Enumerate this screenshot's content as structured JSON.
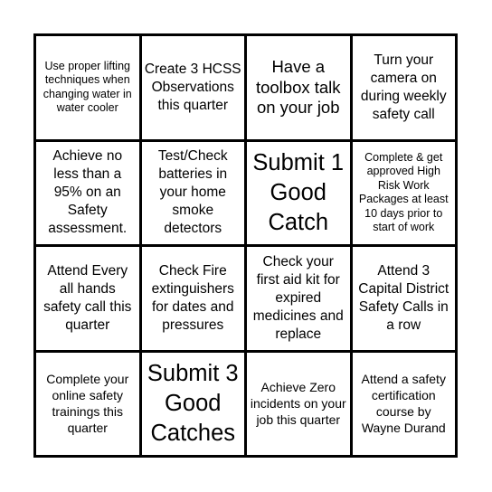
{
  "board": {
    "rows": [
      [
        {
          "text": "Use proper lifting techniques when changing water in water cooler"
        },
        {
          "text": "Create 3 HCSS Observations this quarter"
        },
        {
          "text": "Have a toolbox talk on your job"
        },
        {
          "text": "Turn your camera on during weekly safety call"
        }
      ],
      [
        {
          "text": "Achieve no less than a 95% on an Safety assessment."
        },
        {
          "text": "Test/Check batteries in your home smoke detectors"
        },
        {
          "text": "Submit 1 Good Catch"
        },
        {
          "text": "Complete & get approved High Risk Work Packages at least 10 days prior to start of work"
        }
      ],
      [
        {
          "text": "Attend Every all hands safety call this quarter"
        },
        {
          "text": "Check Fire extinguishers for dates and pressures"
        },
        {
          "text": "Check your first aid kit for expired medicines and replace"
        },
        {
          "text": "Attend 3 Capital District Safety Calls in a row"
        }
      ],
      [
        {
          "text": "Complete your online safety trainings this quarter"
        },
        {
          "text": "Submit 3 Good Catches"
        },
        {
          "text": "Achieve Zero incidents on your job this quarter"
        },
        {
          "text": "Attend a safety certification course by Wayne Durand"
        }
      ]
    ]
  }
}
